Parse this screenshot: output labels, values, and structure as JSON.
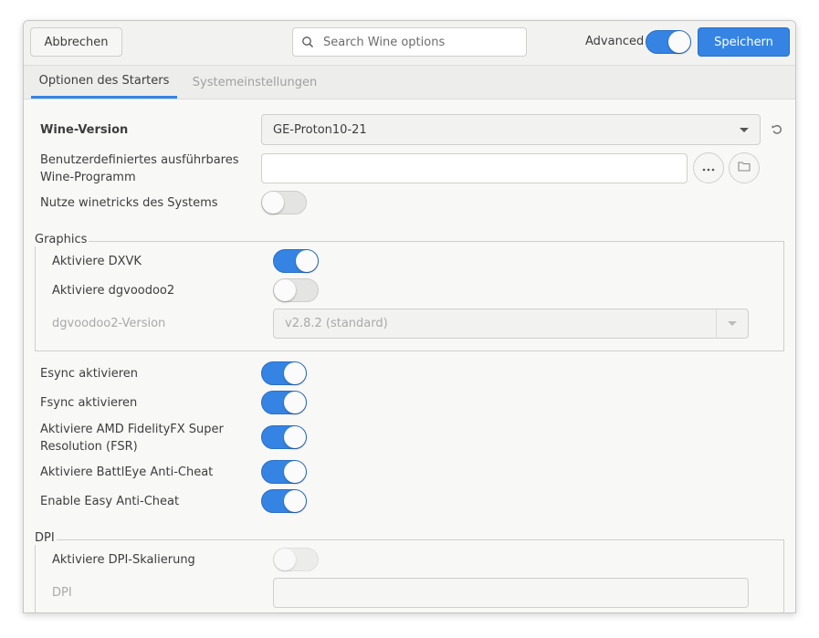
{
  "header": {
    "cancel_label": "Abbrechen",
    "search_placeholder": "Search Wine options",
    "advanced_label": "Advanced",
    "advanced_on": true,
    "save_label": "Speichern"
  },
  "tabs": [
    {
      "label": "Optionen des Starters",
      "active": true
    },
    {
      "label": "Systemeinstellungen",
      "active": false
    }
  ],
  "wine_version": {
    "label": "Wine-Version",
    "value": "GE-Proton10-21"
  },
  "custom_exe": {
    "label": "Benutzerdefiniertes ausführbares Wine-Programm",
    "value": ""
  },
  "winetricks": {
    "label": "Nutze winetricks des Systems",
    "on": false
  },
  "graphics": {
    "title": "Graphics",
    "dxvk": {
      "label": "Aktiviere DXVK",
      "on": true
    },
    "dgvoodoo2": {
      "label": "Aktiviere dgvoodoo2",
      "on": false
    },
    "dgvoodoo2_version": {
      "label": "dgvoodoo2-Version",
      "value": "v2.8.2 (standard)"
    }
  },
  "toggles": [
    {
      "label": "Esync aktivieren",
      "on": true
    },
    {
      "label": "Fsync aktivieren",
      "on": true
    },
    {
      "label": "Aktiviere AMD FidelityFX Super Resolution (FSR)",
      "on": true
    },
    {
      "label": "Aktiviere BattlEye Anti-Cheat",
      "on": true
    },
    {
      "label": "Enable Easy Anti-Cheat",
      "on": true
    }
  ],
  "dpi": {
    "title": "DPI",
    "scaling": {
      "label": "Aktiviere DPI-Skalierung",
      "on": false
    },
    "dpi_field": {
      "label": "DPI",
      "value": ""
    }
  },
  "colors": {
    "accent": "#3584e4",
    "background": "#f8f8f7"
  },
  "icons": [
    "search-icon",
    "reset-icon",
    "ellipsis-icon",
    "folder-icon",
    "chevron-down-icon"
  ]
}
